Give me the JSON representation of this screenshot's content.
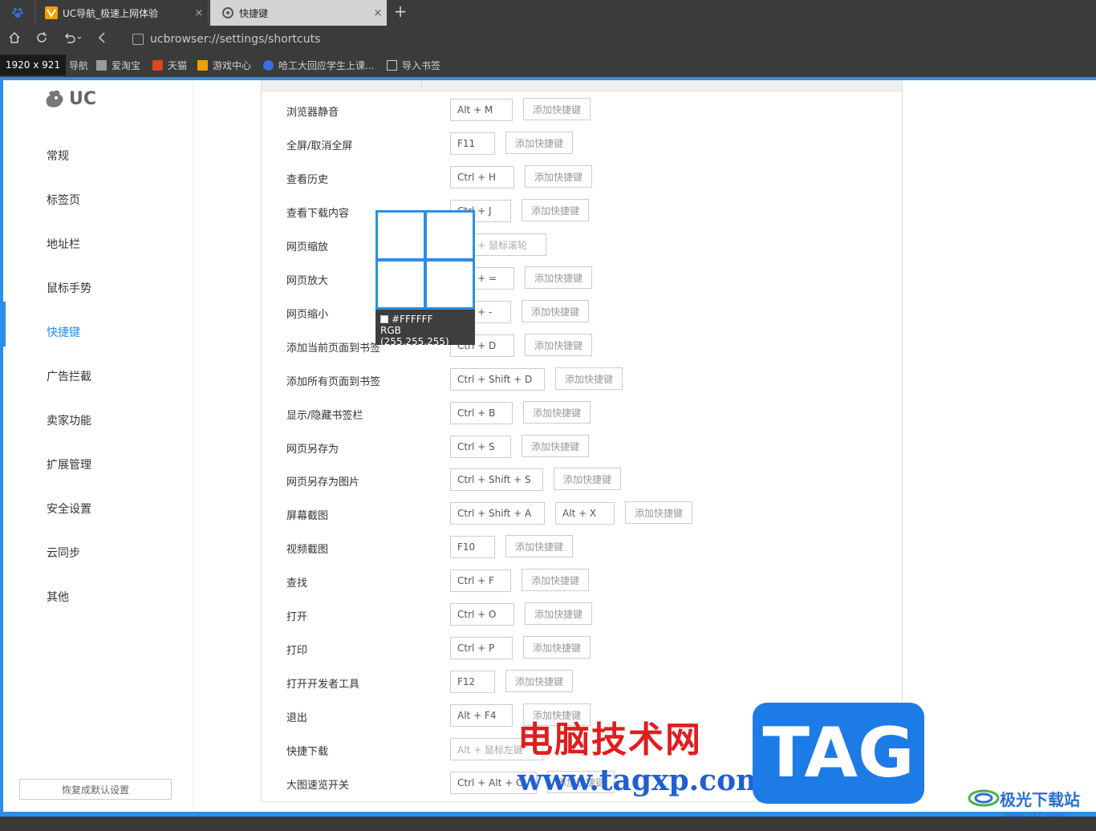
{
  "tabs": [
    {
      "title": "UC导航_极速上网体验",
      "close": "×"
    },
    {
      "title": "快捷键",
      "close": "×"
    }
  ],
  "new_tab": "+",
  "address": {
    "url": "ucbrowser://settings/shortcuts"
  },
  "resolution_badge": "1920 x 921",
  "bookmarks": [
    "导航",
    "爱淘宝",
    "天猫",
    "游戏中心",
    "哈工大回应学生上课...",
    "导入书签"
  ],
  "sidebar": {
    "logo": "UC",
    "items": [
      "常规",
      "标签页",
      "地址栏",
      "鼠标手势",
      "快捷键",
      "广告拦截",
      "卖家功能",
      "扩展管理",
      "安全设置",
      "云同步",
      "其他"
    ],
    "active_index": 4,
    "reset_label": "恢复成默认设置"
  },
  "shortcuts": [
    {
      "label": "浏览器静音",
      "keys": [
        "Alt + M"
      ],
      "add": "添加快捷键"
    },
    {
      "label": "全屏/取消全屏",
      "keys": [
        "F11"
      ],
      "add": "添加快捷键"
    },
    {
      "label": "查看历史",
      "keys": [
        "Ctrl + H"
      ],
      "add": "添加快捷键"
    },
    {
      "label": "查看下载内容",
      "keys": [
        "Ctrl + J"
      ],
      "add": "添加快捷键"
    },
    {
      "label": "网页缩放",
      "keys": [
        "Ctrl + 鼠标滚轮"
      ],
      "add": ""
    },
    {
      "label": "网页放大",
      "keys": [
        "Ctrl + ="
      ],
      "add": "添加快捷键"
    },
    {
      "label": "网页缩小",
      "keys": [
        "Ctrl + -"
      ],
      "add": "添加快捷键"
    },
    {
      "label": "添加当前页面到书签",
      "keys": [
        "Ctrl + D"
      ],
      "add": "添加快捷键"
    },
    {
      "label": "添加所有页面到书签",
      "keys": [
        "Ctrl + Shift + D"
      ],
      "add": "添加快捷键"
    },
    {
      "label": "显示/隐藏书签栏",
      "keys": [
        "Ctrl + B"
      ],
      "add": "添加快捷键"
    },
    {
      "label": "网页另存为",
      "keys": [
        "Ctrl + S"
      ],
      "add": "添加快捷键"
    },
    {
      "label": "网页另存为图片",
      "keys": [
        "Ctrl + Shift + S"
      ],
      "add": "添加快捷键"
    },
    {
      "label": "屏幕截图",
      "keys": [
        "Ctrl + Shift + A",
        "Alt + X"
      ],
      "add": "添加快捷键"
    },
    {
      "label": "视频截图",
      "keys": [
        "F10"
      ],
      "add": "添加快捷键"
    },
    {
      "label": "查找",
      "keys": [
        "Ctrl + F"
      ],
      "add": "添加快捷键"
    },
    {
      "label": "打开",
      "keys": [
        "Ctrl + O"
      ],
      "add": "添加快捷键"
    },
    {
      "label": "打印",
      "keys": [
        "Ctrl + P"
      ],
      "add": "添加快捷键"
    },
    {
      "label": "打开开发者工具",
      "keys": [
        "F12"
      ],
      "add": "添加快捷键"
    },
    {
      "label": "退出",
      "keys": [
        "Alt + F4"
      ],
      "add": "添加快捷键"
    },
    {
      "label": "快捷下载",
      "keys": [
        "Alt + 鼠标左键"
      ],
      "add": ""
    },
    {
      "label": "大图速览开关",
      "keys": [
        "Ctrl + Alt + C"
      ],
      "add": "添加快捷键"
    }
  ],
  "color_picker": {
    "hex": "#FFFFFF",
    "rgb": "RGB (255,255,255)"
  },
  "watermark": {
    "site_name": "电脑技术网",
    "url": "www.tagxp.com",
    "tag": "TAG",
    "corner_name": "极光下载站",
    "corner_url": "www.xz7.com"
  },
  "colors": {
    "accent": "#2b8ee7",
    "watermark_red": "#e11d1d",
    "watermark_blue": "#1f5fd4"
  }
}
